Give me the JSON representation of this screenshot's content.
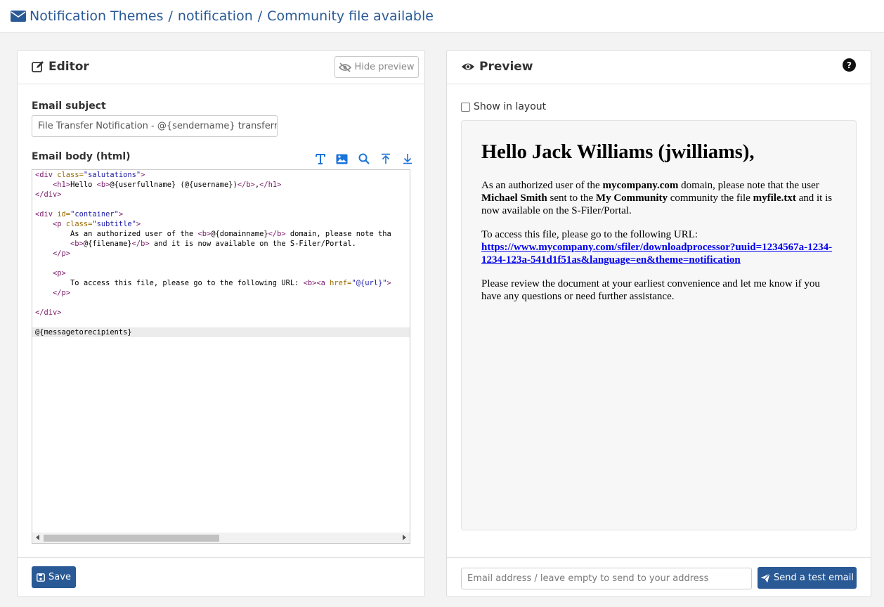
{
  "breadcrumb": {
    "icon": "envelope-icon",
    "items": [
      "Notification Themes",
      "notification",
      "Community file available"
    ],
    "separator": "/"
  },
  "editor": {
    "title": "Editor",
    "hide_preview_label": "Hide preview",
    "subject_label": "Email subject",
    "subject_value": "File Transfer Notification - @{sendername} transferred",
    "body_label": "Email body (html)",
    "toolbar_icons": [
      "text-format-icon",
      "image-icon",
      "search-icon",
      "upload-icon",
      "download-icon"
    ],
    "code_lines": [
      "<div class=\"salutations\">",
      "    <h1>Hello <b>@{userfullname} (@{username})</b>,</h1>",
      "</div>",
      "",
      "<div id=\"container\">",
      "    <p class=\"subtitle\">",
      "        As an authorized user of the <b>@{domainname}</b> domain, please note tha",
      "        <b>@{filename}</b> and it is now available on the S-Filer/Portal.",
      "    </p>",
      "",
      "    <p>",
      "        To access this file, please go to the following URL: <b><a href=\"@{url}\">",
      "    </p>",
      "",
      "</div>",
      "",
      "@{messagetorecipients}"
    ],
    "save_label": "Save"
  },
  "preview": {
    "title": "Preview",
    "help_icon": "question-circle-icon",
    "show_in_layout_label": "Show in layout",
    "show_in_layout_checked": false,
    "mail": {
      "heading": "Hello Jack Williams (jwilliams),",
      "p1_a": "As an authorized user of the ",
      "domain": "mycompany.com",
      "p1_b": " domain, please note that the user ",
      "sender": "Michael Smith",
      "p1_c": " sent to the ",
      "community": "My Community",
      "p1_d": " community the file ",
      "filename": "myfile.txt",
      "p1_e": " and it is now available on the S-Filer/Portal.",
      "p2_a": "To access this file, please go to the following URL:",
      "url": "https://www.mycompany.com/sfiler/downloadprocessor?uuid=1234567a-1234-1234-123a-541d1f51as&language=en&theme=notification",
      "p3": "Please review the document at your earliest convenience and let me know if you have any questions or need further assistance."
    },
    "email_placeholder": "Email address / leave empty to send to your address",
    "send_label": "Send a test email"
  },
  "colors": {
    "brand": "#2a5a96",
    "toolbar_icon": "#1a73d9",
    "code_tag": "#7a1a6a",
    "code_attr": "#9b6b00",
    "code_string": "#1a1aa6",
    "link": "#0000ee"
  }
}
